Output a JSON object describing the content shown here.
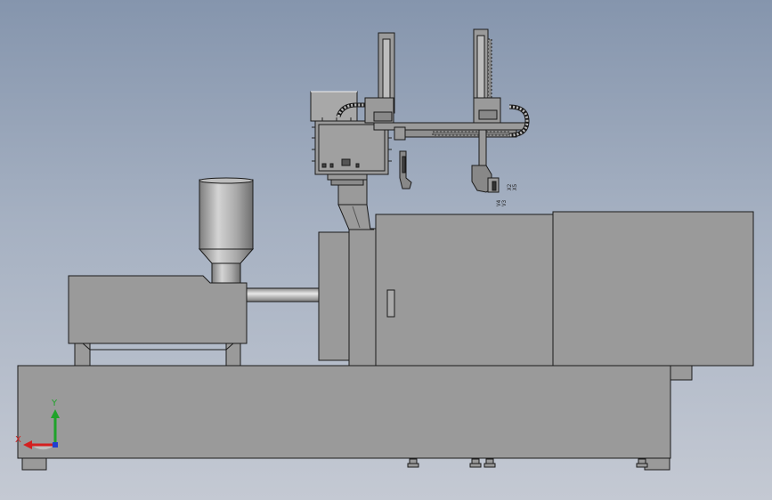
{
  "viewport": {
    "background_top": "#8595ad",
    "background_bottom": "#c4c9d3"
  },
  "model": {
    "body_color": "#9a9a9a",
    "edge_color": "#1a1a1a",
    "shade_color": "#8a8a8a",
    "mold_labels": [
      "V4",
      "V3",
      "X2",
      "X5"
    ]
  },
  "triad": {
    "x_label": "X",
    "y_label": "Y",
    "x_color": "#d42020",
    "y_color": "#1fa32a",
    "z_color": "#2040d0"
  }
}
